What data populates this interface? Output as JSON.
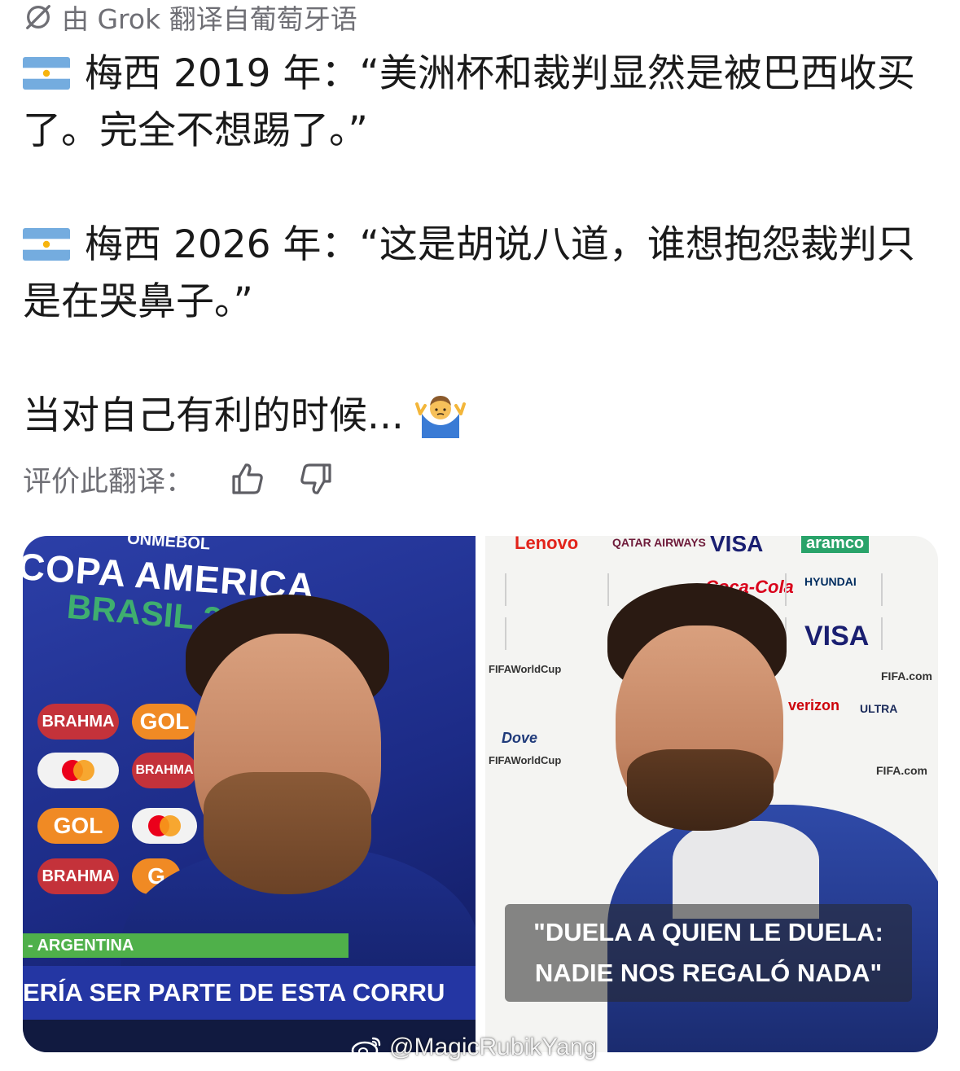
{
  "header": {
    "translated_by": "由 Grok 翻译自葡萄牙语"
  },
  "post": {
    "paragraphs": [
      {
        "flag": "argentina-flag-emoji",
        "text": "梅西 2019 年：“美洲杯和裁判显然是被巴西收买了。完全不想踢了。”"
      },
      {
        "flag": "argentina-flag-emoji",
        "text": "梅西 2026 年：“这是胡说八道，谁想抱怨裁判只是在哭鼻子。”"
      },
      {
        "emoji": "man-shrugging-emoji",
        "text": "当对自己有利的时候..."
      }
    ]
  },
  "rating": {
    "label": "评价此翻译：",
    "thumbs_up_icon": "thumbs-up-icon",
    "thumbs_down_icon": "thumbs-down-icon"
  },
  "media": {
    "left": {
      "org": "ONMEBOL",
      "title": "COPA AMERICA",
      "subtitle": "BRASIL 20",
      "sponsors": [
        "BRAHMA",
        "GOL",
        "BRAHMA",
        "GOL",
        "BRAHMA",
        "G"
      ],
      "team_bar": "- ARGENTINA",
      "caption": "ERÍA SER PARTE DE ESTA CORRU"
    },
    "right": {
      "backdrop": [
        "Lenovo",
        "QATAR AIRWAYS",
        "VISA",
        "aramco",
        "HYUNDAI",
        "VISA",
        "Coca-Cola",
        "FIFAWorldCup",
        "FIFA.com",
        "verizon",
        "ULTRA",
        "Dove",
        "FIFAWorldCup",
        "FIFA.com"
      ],
      "subtitle_line1": "\"DUELA A QUIEN LE DUELA:",
      "subtitle_line2": "NADIE NOS REGALÓ NADA\""
    }
  },
  "watermark": {
    "text": "@MagicRubikYang",
    "icon": "weibo-logo-icon"
  },
  "colors": {
    "text": "#1a1a1a",
    "muted": "#6f6f75",
    "copa_blue": "#2436a3",
    "arg_sky": "#74acdf"
  }
}
